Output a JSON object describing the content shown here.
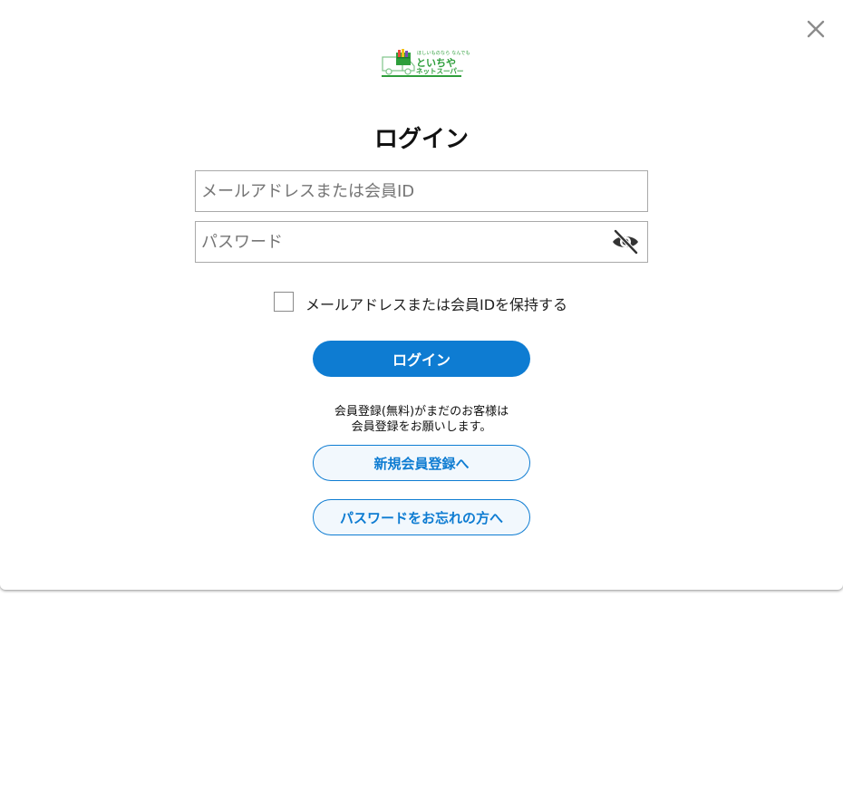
{
  "header": {
    "close_icon": "close-icon",
    "logo": {
      "small_text": "ほしいものなら なんでも",
      "main_text": "といちや",
      "sub_text": "ネットスーパー",
      "brand_color": "#2e9e3b"
    }
  },
  "login": {
    "title": "ログイン",
    "email_placeholder": "メールアドレスまたは会員ID",
    "password_placeholder": "パスワード",
    "password_toggle_icon": "eye-slash-icon",
    "remember_label": "メールアドレスまたは会員IDを保持する",
    "remember_checked": false,
    "submit_label": "ログイン"
  },
  "register": {
    "note_line1": "会員登録(無料)がまだのお客様は",
    "note_line2": "会員登録をお願いします。",
    "register_label": "新規会員登録へ",
    "forgot_label": "パスワードをお忘れの方へ"
  },
  "colors": {
    "accent": "#0e7cd2",
    "outline_button_bg": "#f2f8fd"
  }
}
